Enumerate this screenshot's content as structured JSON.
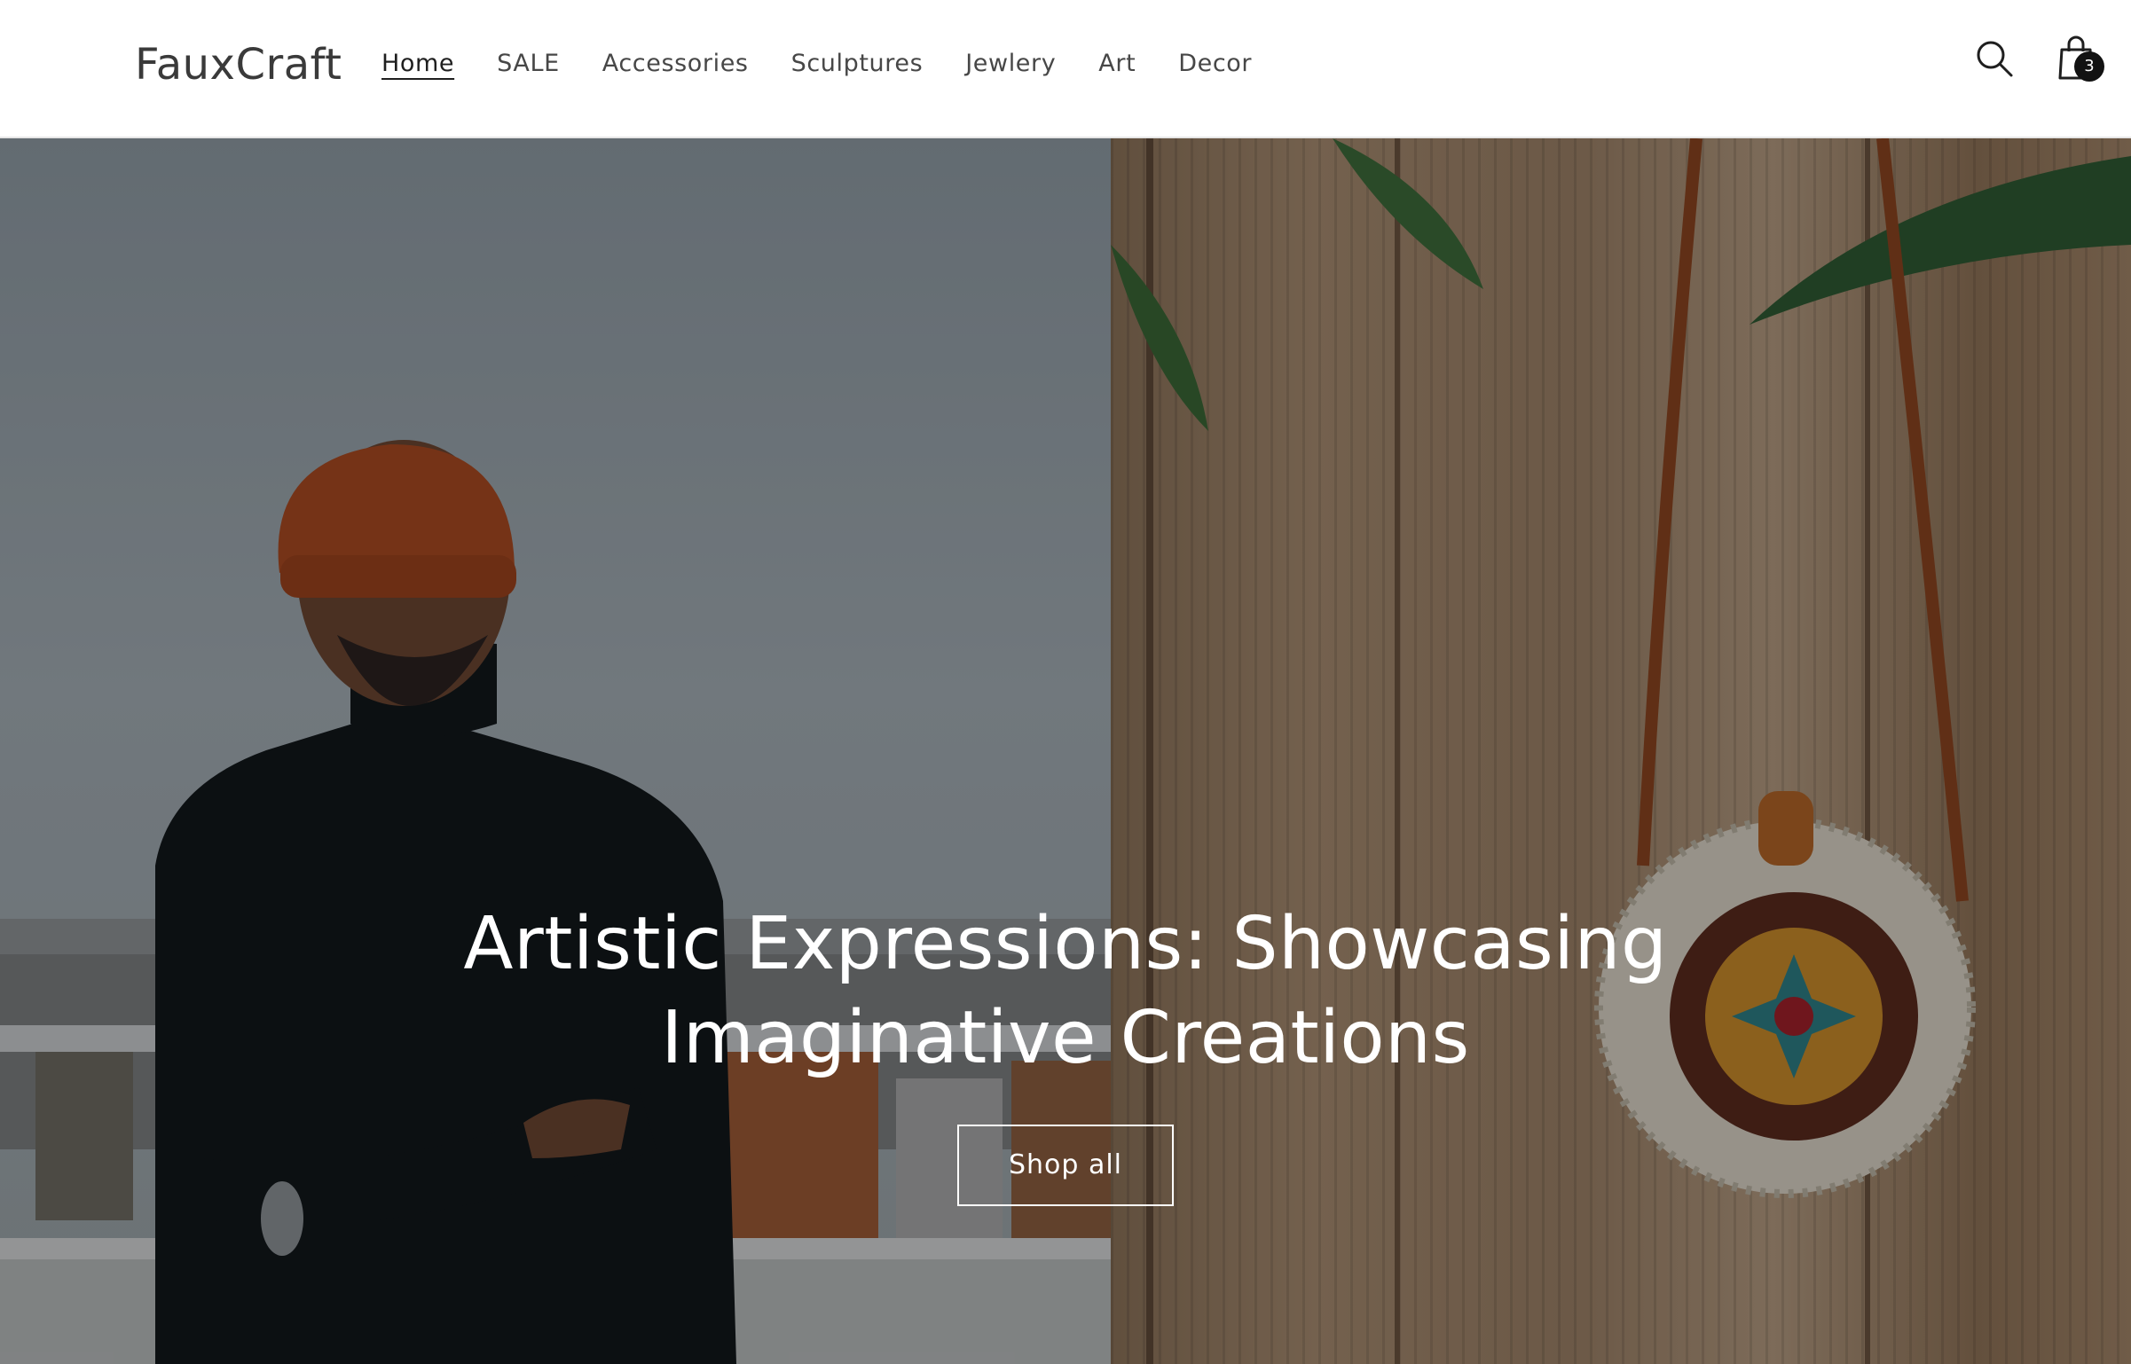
{
  "header": {
    "brand": "FauxCraft",
    "nav": [
      {
        "label": "Home",
        "active": true
      },
      {
        "label": "SALE"
      },
      {
        "label": "Accessories"
      },
      {
        "label": "Sculptures"
      },
      {
        "label": "Jewlery"
      },
      {
        "label": "Art"
      },
      {
        "label": "Decor"
      }
    ],
    "search_icon": "search-icon",
    "cart_icon": "shopping-bag-icon",
    "cart_count": "3"
  },
  "hero": {
    "title": "Artistic Expressions: Showcasing Imaginative Creations",
    "button_label": "Shop all",
    "left_image": "man in orange beanie and black turtleneck on rooftop",
    "right_image": "round rattan bag hanging on wooden wall"
  },
  "colors": {
    "header_bg": "#ffffff",
    "text": "#3a3a3a",
    "hero_text": "#ffffff",
    "badge_bg": "#121212"
  }
}
